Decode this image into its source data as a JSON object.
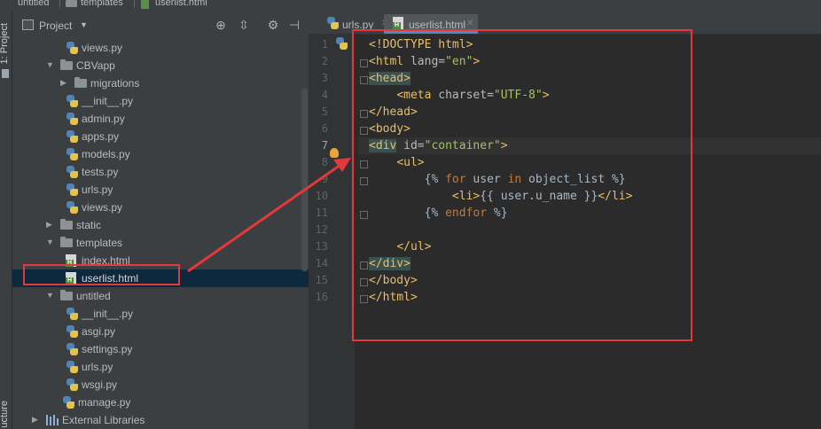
{
  "breadcrumb": {
    "items": [
      "untitled",
      "templates",
      "userlist.html"
    ]
  },
  "left_toolbar": {
    "project_tab": "1: Project",
    "structure_tab": "ucture"
  },
  "project_panel": {
    "title": "Project",
    "header_icons": [
      "crosshair-icon",
      "collapse-icon",
      "gear-icon",
      "hide-panel-icon"
    ]
  },
  "tree": [
    {
      "label": "views.py",
      "type": "py",
      "indent": 3
    },
    {
      "label": "CBVapp",
      "type": "folder",
      "indent": 1,
      "expanded": true
    },
    {
      "label": "migrations",
      "type": "folder",
      "indent": 2,
      "expanded": false
    },
    {
      "label": "__init__.py",
      "type": "py",
      "indent": 3
    },
    {
      "label": "admin.py",
      "type": "py",
      "indent": 3
    },
    {
      "label": "apps.py",
      "type": "py",
      "indent": 3
    },
    {
      "label": "models.py",
      "type": "py",
      "indent": 3
    },
    {
      "label": "tests.py",
      "type": "py",
      "indent": 3
    },
    {
      "label": "urls.py",
      "type": "py",
      "indent": 3
    },
    {
      "label": "views.py",
      "type": "py",
      "indent": 3
    },
    {
      "label": "static",
      "type": "folder",
      "indent": 1,
      "expanded": false
    },
    {
      "label": "templates",
      "type": "folder",
      "indent": 1,
      "expanded": true
    },
    {
      "label": "index.html",
      "type": "html",
      "indent": 3
    },
    {
      "label": "userlist.html",
      "type": "html",
      "indent": 3,
      "selected": true
    },
    {
      "label": "untitled",
      "type": "folder",
      "indent": 1,
      "expanded": true
    },
    {
      "label": "__init__.py",
      "type": "py",
      "indent": 3
    },
    {
      "label": "asgi.py",
      "type": "py",
      "indent": 3
    },
    {
      "label": "settings.py",
      "type": "py",
      "indent": 3
    },
    {
      "label": "urls.py",
      "type": "py",
      "indent": 3
    },
    {
      "label": "wsgi.py",
      "type": "py",
      "indent": 3
    },
    {
      "label": "manage.py",
      "type": "py",
      "indent": 2
    },
    {
      "label": "External Libraries",
      "type": "lib",
      "indent": 0,
      "expanded": false
    }
  ],
  "tabs": [
    {
      "label": "urls.py",
      "active": false
    },
    {
      "label": "userlist.html",
      "active": true
    }
  ],
  "editor": {
    "line_numbers": [
      "1",
      "2",
      "3",
      "4",
      "5",
      "6",
      "7",
      "8",
      "9",
      "10",
      "11",
      "12",
      "13",
      "14",
      "15",
      "16"
    ],
    "current_line": 7
  },
  "colors": {
    "annotation_red": "#e5383b",
    "tab_accent": "#4a88c7",
    "selection": "#0d293e"
  }
}
